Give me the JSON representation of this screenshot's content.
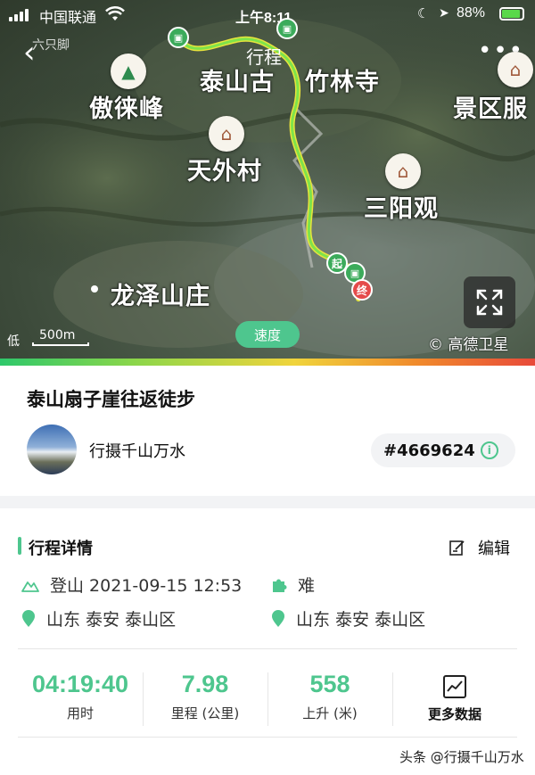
{
  "status_bar": {
    "carrier": "中国联通",
    "time": "上午8:11",
    "battery": "88%"
  },
  "nav": {
    "brand": "六只脚",
    "title": "行程"
  },
  "map": {
    "places": {
      "aolai_peak": "傲徕峰",
      "temple": "泰山古",
      "temple2": "竹林寺",
      "tianwai_village": "天外村",
      "sanyang_guan": "三阳观",
      "longze": "龙泽山庄",
      "scenic": "景区服"
    },
    "start_marker": "起",
    "end_marker": "终",
    "scale_low": "低",
    "scale_label": "500m",
    "speed_chip": "速度",
    "copyright": "© 高德卫星"
  },
  "route": {
    "title": "泰山扇子崖往返徒步",
    "user_name": "行摄千山万水",
    "trip_id": "#4669624",
    "info_icon": "i"
  },
  "details": {
    "section_title": "行程详情",
    "edit_label": "编辑",
    "activity": "登山 2021-09-15 12:53",
    "difficulty": "难",
    "start_location": "山东 泰安 泰山区",
    "end_location": "山东 泰安 泰山区",
    "start_badge": "起",
    "end_badge": "终"
  },
  "stats": [
    {
      "value": "04:19:40",
      "label": "用时"
    },
    {
      "value": "7.98",
      "label": "里程 (公里)"
    },
    {
      "value": "558",
      "label": "上升 (米)"
    },
    {
      "value": "",
      "label": "更多数据"
    }
  ],
  "watermark": "头条 @行摄千山万水",
  "colors": {
    "accent": "#4ec68e",
    "end_red": "#e54b4b"
  }
}
